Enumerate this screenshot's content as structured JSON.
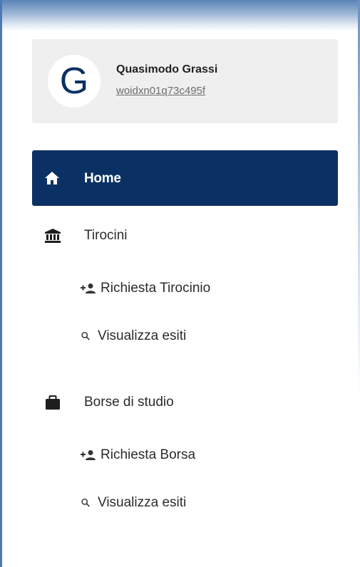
{
  "user": {
    "initial": "G",
    "name": "Quasimodo Grassi",
    "id": "woidxn01q73c495f"
  },
  "nav": {
    "home": {
      "label": "Home",
      "icon": "home-icon"
    },
    "tirocini": {
      "label": "Tirocini",
      "icon": "institution-icon",
      "children": [
        {
          "label": "Richiesta Tirocinio",
          "icon": "add-user-icon"
        },
        {
          "label": "Visualizza esiti",
          "icon": "search-icon"
        }
      ]
    },
    "borse": {
      "label": "Borse di studio",
      "icon": "briefcase-icon",
      "children": [
        {
          "label": "Richiesta Borsa",
          "icon": "add-user-icon"
        },
        {
          "label": "Visualizza esiti",
          "icon": "search-icon"
        }
      ]
    }
  },
  "colors": {
    "primary": "#0b3063",
    "text": "#2b2b2b",
    "muted": "#6c6c6c",
    "card": "#efefef"
  }
}
